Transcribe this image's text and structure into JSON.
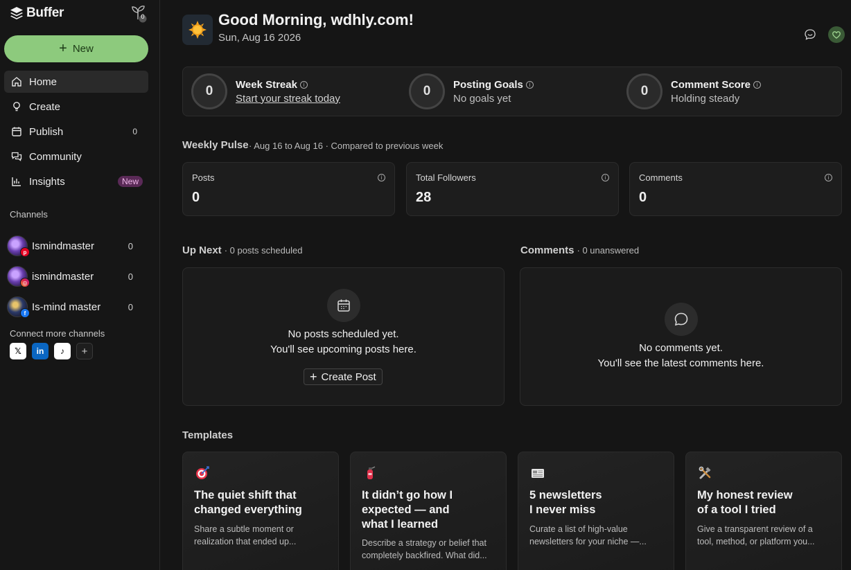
{
  "app": {
    "brand": "Buffer",
    "plant_count": "0"
  },
  "sidebar": {
    "new_label": "New",
    "nav": [
      {
        "label": "Home",
        "icon": "home-icon",
        "count": "",
        "badge": ""
      },
      {
        "label": "Create",
        "icon": "lightbulb-icon",
        "count": "",
        "badge": ""
      },
      {
        "label": "Publish",
        "icon": "calendar-icon",
        "count": "0",
        "badge": ""
      },
      {
        "label": "Community",
        "icon": "chat-icon",
        "count": "",
        "badge": ""
      },
      {
        "label": "Insights",
        "icon": "bar-chart-icon",
        "count": "",
        "badge": "New"
      }
    ],
    "channels_label": "Channels",
    "channels": [
      {
        "name": "Ismindmaster",
        "network": "pinterest",
        "count": "0"
      },
      {
        "name": "ismindmaster",
        "network": "instagram",
        "count": "0"
      },
      {
        "name": "Is-mind master",
        "network": "facebook",
        "count": "0"
      }
    ],
    "connect_label": "Connect more channels",
    "connect_networks": [
      "x",
      "linkedin",
      "tiktok",
      "add"
    ]
  },
  "header": {
    "greeting": "Good Morning, wdhly.com!",
    "date": "Sun, Aug 16 2026"
  },
  "stats": [
    {
      "value": "0",
      "title": "Week Streak",
      "sub": "Start your streak today",
      "is_link": true
    },
    {
      "value": "0",
      "title": "Posting Goals",
      "sub": "No goals yet",
      "is_link": false
    },
    {
      "value": "0",
      "title": "Comment Score",
      "sub": "Holding steady",
      "is_link": false
    }
  ],
  "weekly_pulse": {
    "title": "Weekly Pulse",
    "subtitle": "· Aug 16 to Aug 16 · Compared to previous week",
    "metrics": [
      {
        "label": "Posts",
        "value": "0"
      },
      {
        "label": "Total Followers",
        "value": "28"
      },
      {
        "label": "Comments",
        "value": "0"
      }
    ]
  },
  "up_next": {
    "title": "Up Next",
    "subtitle": "· 0 posts scheduled",
    "empty_line1": "No posts scheduled yet.",
    "empty_line2": "You'll see upcoming posts here.",
    "button": "Create Post"
  },
  "comments": {
    "title": "Comments",
    "subtitle": "· 0 unanswered",
    "empty_line1": "No comments yet.",
    "empty_line2": "You'll see the latest comments here."
  },
  "templates": {
    "title": "Templates",
    "items": [
      {
        "icon": "target-icon",
        "title_l1": "The quiet shift that",
        "title_l2": "changed everything",
        "title_l3": "",
        "desc_l1": "Share a subtle moment or",
        "desc_l2": "realization that ended up..."
      },
      {
        "icon": "fire-extinguisher-icon",
        "title_l1": "It didn’t go how I",
        "title_l2": "expected — and",
        "title_l3": "what I learned",
        "desc_l1": "Describe a strategy or belief that",
        "desc_l2": "completely backfired. What did..."
      },
      {
        "icon": "newspaper-icon",
        "title_l1": "5 newsletters",
        "title_l2": "I never miss",
        "title_l3": "",
        "desc_l1": "Curate a list of high-value",
        "desc_l2": "newsletters for your niche —..."
      },
      {
        "icon": "tools-icon",
        "title_l1": "My honest review",
        "title_l2": "of a tool I tried",
        "title_l3": "",
        "desc_l1": "Give a transparent review of a",
        "desc_l2": "tool, method, or platform you..."
      }
    ]
  }
}
